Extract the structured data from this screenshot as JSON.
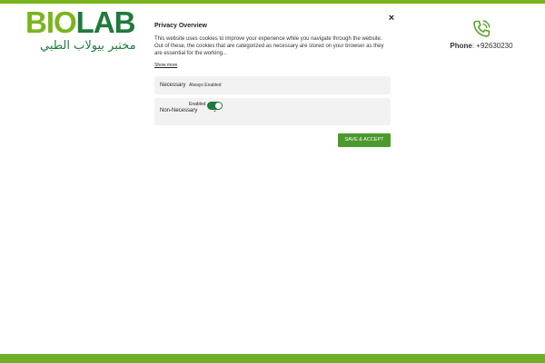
{
  "colors": {
    "accent": "#7ab51d",
    "dark_green": "#1f7a3c",
    "button": "#4a9a2c",
    "row_bg": "#f2f2f2"
  },
  "header": {
    "logo": {
      "part1": "BIO",
      "part2": "LAB",
      "arabic": "مختبر بيولاب الطبي"
    },
    "phone": {
      "label": "Phone",
      "number": ": +92630230",
      "icon": "phone-call-icon"
    }
  },
  "privacy_modal": {
    "title": "Privacy Overview",
    "description": "This website uses cookies to improve your experience while you navigate through the website. Out of these, the cookies that are categorized as necessary are stored on your browser as they are essential for the working...",
    "show_more": "Show more",
    "close_symbol": "×",
    "necessary": {
      "title": "Necessary",
      "status": "Always Enabled"
    },
    "non_necessary": {
      "title": "Non-Necessary",
      "toggle_label": "Enabled",
      "toggle_on": true,
      "chevron": "⌄"
    },
    "save_button": "SAVE & ACCEPT"
  }
}
